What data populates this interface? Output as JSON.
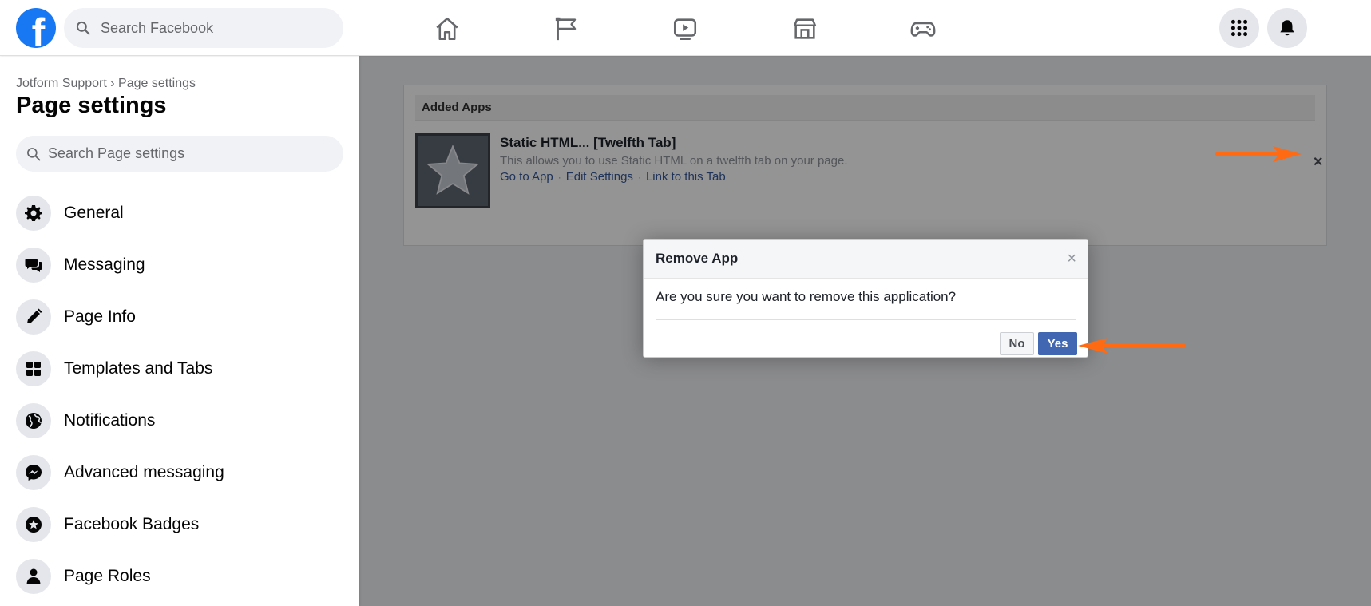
{
  "topbar": {
    "logo": "facebook-logo",
    "logo_letter": "f",
    "search_placeholder": "Search Facebook",
    "nav": [
      "home-icon",
      "flag-icon",
      "watch-icon",
      "marketplace-icon",
      "gaming-icon"
    ],
    "right": [
      "menu-grid-icon",
      "notifications-bell-icon"
    ]
  },
  "sidebar": {
    "breadcrumb": "Jotform Support › Page settings",
    "title": "Page settings",
    "search_placeholder": "Search Page settings",
    "items": [
      {
        "label": "General",
        "icon": "gear-icon"
      },
      {
        "label": "Messaging",
        "icon": "chat-bubbles-icon"
      },
      {
        "label": "Page Info",
        "icon": "pencil-icon"
      },
      {
        "label": "Templates and Tabs",
        "icon": "grid-icon"
      },
      {
        "label": "Notifications",
        "icon": "globe-icon"
      },
      {
        "label": "Advanced messaging",
        "icon": "messenger-icon"
      },
      {
        "label": "Facebook Badges",
        "icon": "star-badge-icon"
      },
      {
        "label": "Page Roles",
        "icon": "person-icon"
      }
    ]
  },
  "apps": {
    "header": "Added Apps",
    "app": {
      "name": "Static HTML... [Twelfth Tab]",
      "description": "This allows you to use Static HTML on a twelfth tab on your page.",
      "links": [
        "Go to App",
        "Edit Settings",
        "Link to this Tab"
      ],
      "separator": "·",
      "remove_glyph": "✕"
    }
  },
  "dialog": {
    "title": "Remove App",
    "close_glyph": "×",
    "body": "Are you sure you want to remove this application?",
    "no_label": "No",
    "yes_label": "Yes"
  },
  "colors": {
    "fb_blue": "#1877f2",
    "yes_button": "#4267b2",
    "annotation_arrow": "#ff6a13",
    "link": "#365899"
  }
}
